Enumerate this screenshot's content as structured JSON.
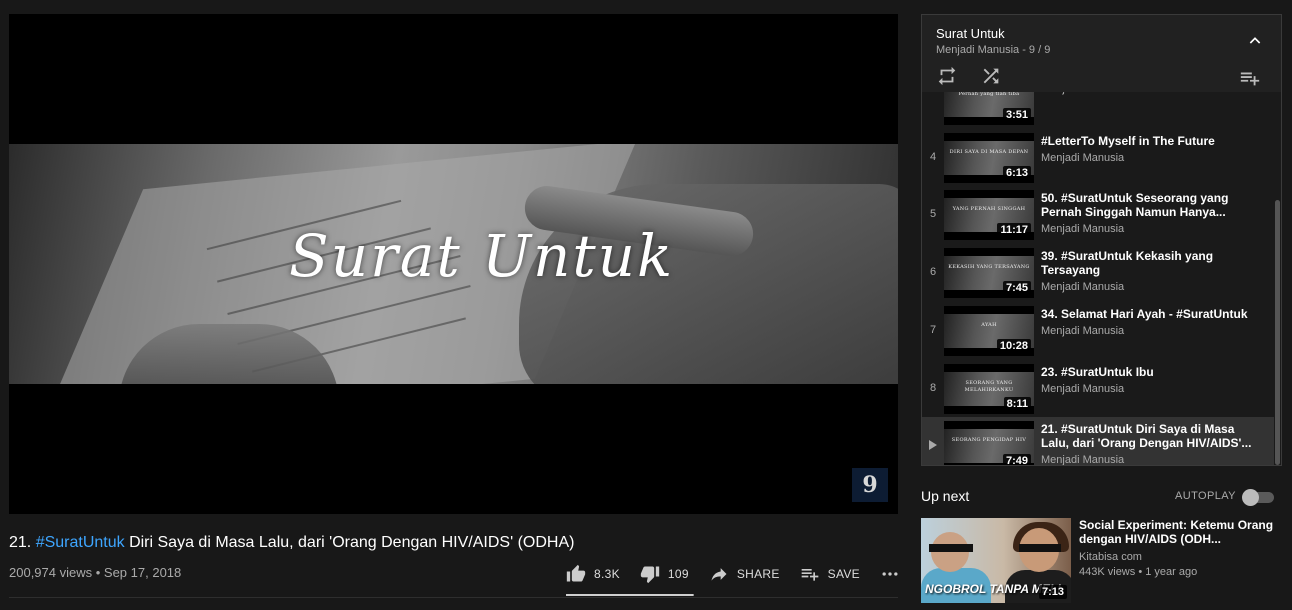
{
  "player": {
    "frame_title": "Surat Untuk",
    "channel_badge": "9"
  },
  "video": {
    "title_prefix": "21. ",
    "title_hashtag": "#SuratUntuk",
    "title_rest": " Diri Saya di Masa Lalu, dari 'Orang Dengan HIV/AIDS' (ODHA)",
    "views": "200,974 views",
    "separator": " • ",
    "date": "Sep 17, 2018",
    "likes": "8.3K",
    "dislikes": "109",
    "share_label": "SHARE",
    "save_label": "SAVE",
    "like_ratio": 0.987
  },
  "playlist": {
    "title": "Surat Untuk",
    "subtitle": "Menjadi Manusia - 9 / 9",
    "items": [
      {
        "index": "",
        "title": "",
        "channel": "Menjadi Manusia",
        "duration": "3:51",
        "caption": "Pernah yang tlah tiba",
        "active": false
      },
      {
        "index": "4",
        "title": "#LetterTo Myself in The Future",
        "channel": "Menjadi Manusia",
        "duration": "6:13",
        "caption": "DIRI SAYA DI MASA DEPAN",
        "active": false
      },
      {
        "index": "5",
        "title": "50. #SuratUntuk Seseorang yang Pernah Singgah Namun Hanya...",
        "channel": "Menjadi Manusia",
        "duration": "11:17",
        "caption": "YANG PERNAH SINGGAH",
        "active": false
      },
      {
        "index": "6",
        "title": "39. #SuratUntuk Kekasih yang Tersayang",
        "channel": "Menjadi Manusia",
        "duration": "7:45",
        "caption": "KEKASIH YANG TERSAYANG",
        "active": false
      },
      {
        "index": "7",
        "title": "34. Selamat Hari Ayah - #SuratUntuk",
        "channel": "Menjadi Manusia",
        "duration": "10:28",
        "caption": "AYAH",
        "active": false
      },
      {
        "index": "8",
        "title": "23. #SuratUntuk Ibu",
        "channel": "Menjadi Manusia",
        "duration": "8:11",
        "caption": "SEORANG YANG MELAHIRKANKU",
        "active": false
      },
      {
        "index": "",
        "title": "21. #SuratUntuk Diri Saya di Masa Lalu, dari 'Orang Dengan HIV/AIDS'...",
        "channel": "Menjadi Manusia",
        "duration": "7:49",
        "caption": "SEORANG PENGIDAP HIV",
        "active": true,
        "watched": 0.25
      }
    ]
  },
  "upnext": {
    "label": "Up next",
    "autoplay_label": "AUTOPLAY",
    "autoplay_on": false,
    "video": {
      "title": "Social Experiment: Ketemu Orang dengan HIV/AIDS (ODH...",
      "channel": "Kitabisa com",
      "views": "443K views",
      "separator": " • ",
      "age": "1 year ago",
      "duration": "7:13",
      "thumb_text": "NGOBROL TANPA MELI"
    }
  }
}
